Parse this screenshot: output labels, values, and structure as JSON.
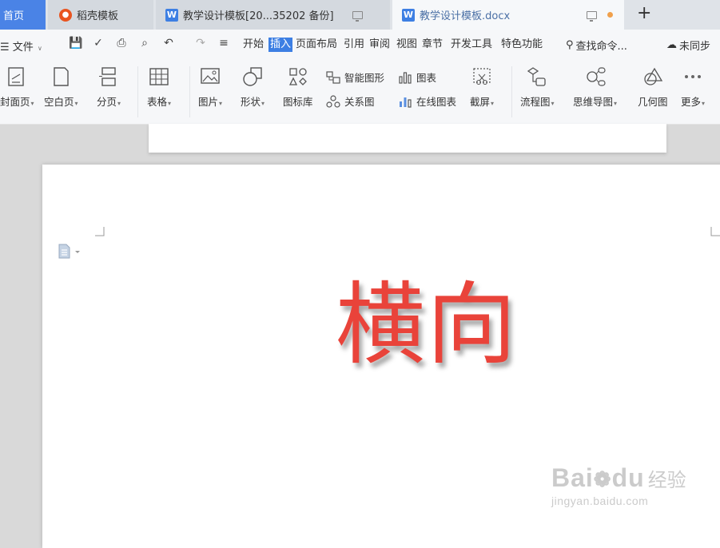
{
  "tabs": {
    "home": "首页",
    "daoke": "稻壳模板",
    "doc_backup": "教学设计模板[20...35202 备份]",
    "doc_active": "教学设计模板.docx"
  },
  "menu": {
    "file_label": "文件",
    "tabs": [
      "开始",
      "插入",
      "页面布局",
      "引用",
      "审阅",
      "视图",
      "章节",
      "开发工具",
      "特色功能"
    ],
    "active_tab": "插入",
    "search_label": "查找命令...",
    "sync_label": "未同步"
  },
  "ribbon": {
    "cover_page": "封面页",
    "blank_page": "空白页",
    "page_break": "分页",
    "table": "表格",
    "picture": "图片",
    "shape": "形状",
    "icon_library": "图标库",
    "smart_graphic": "智能图形",
    "relationship": "关系图",
    "chart": "图表",
    "online_chart": "在线图表",
    "screenshot": "截屏",
    "flowchart": "流程图",
    "mind_map": "思维导图",
    "geometry": "几何图",
    "more": "更多"
  },
  "document": {
    "text": "横向",
    "text_color": "#e9433a"
  },
  "watermark": {
    "brand": "Bai",
    "brand_suffix": "du",
    "cn": "经验",
    "url": "jingyan.baidu.com"
  },
  "colors": {
    "accent": "#3d7fe3",
    "home_tab": "#4a83e6",
    "unsaved_dot": "#f0a04b"
  }
}
